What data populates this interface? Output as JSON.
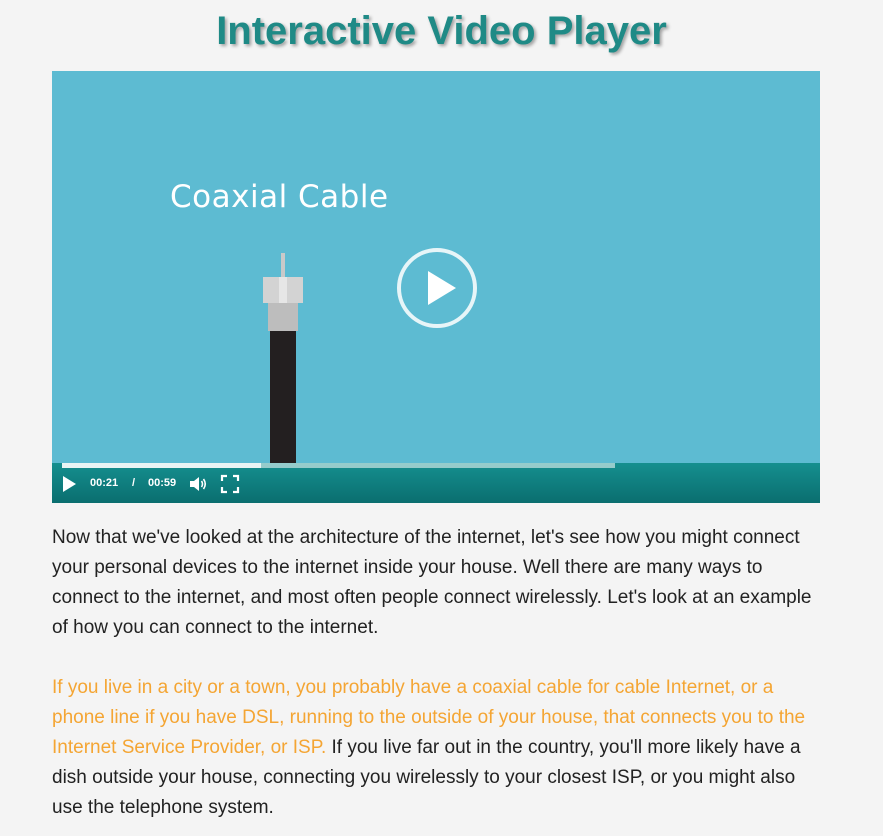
{
  "page": {
    "title": "Interactive Video Player"
  },
  "video": {
    "caption": "Coaxial Cable",
    "current_time": "00:21",
    "separator": "/",
    "duration": "00:59",
    "progress_fraction": 0.36,
    "colors": {
      "background": "#5dbbd2",
      "controls": "#0f8080"
    },
    "icons": {
      "big_play": "play-circle-icon",
      "play": "play-icon",
      "volume": "volume-icon",
      "fullscreen": "fullscreen-icon"
    }
  },
  "content": {
    "paragraph1": "Now that we've looked at the architecture of the internet, let's see how you might connect your personal devices to the internet inside your house. Well there are many ways to connect to the internet, and most often people connect wirelessly. Let's look at an example of how you can connect to the internet.",
    "paragraph2_highlight": "If you live in a city or a town, you probably have a coaxial cable for cable Internet, or a phone line if you have DSL, running to the outside of your house, that connects you to the Internet Service Provider, or ISP.",
    "paragraph2_rest": " If you live far out in the country, you'll more likely have a dish outside your house, connecting you wirelessly to your closest ISP, or you might also use the telephone system.",
    "highlight_color": "#f4a533"
  }
}
